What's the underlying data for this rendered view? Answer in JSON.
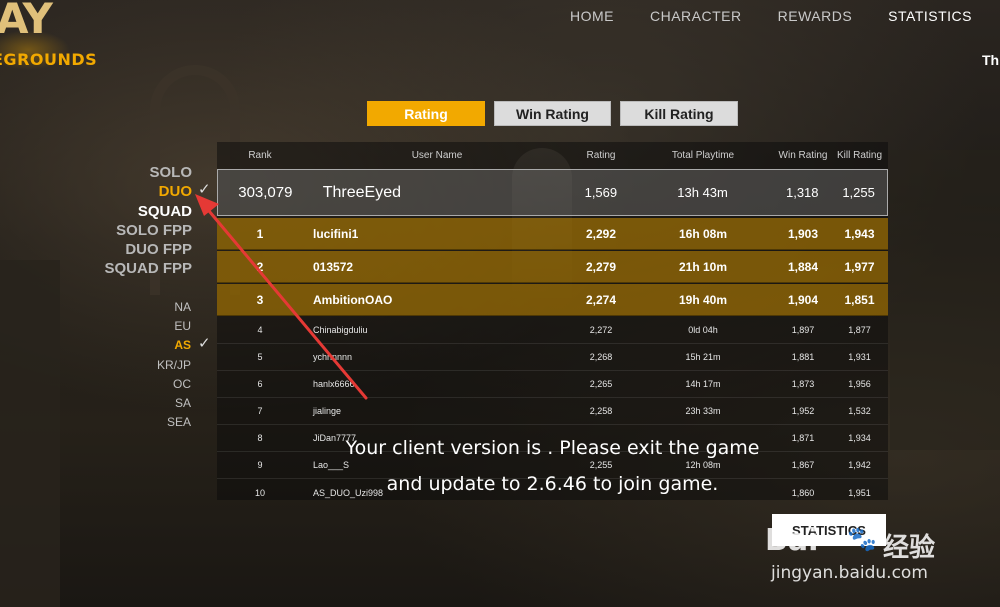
{
  "logo": {
    "big": "AY",
    "small": "EGROUNDS"
  },
  "nav": {
    "items": [
      "HOME",
      "CHARACTER",
      "REWARDS",
      "STATISTICS"
    ],
    "sub": "Th"
  },
  "tabs": [
    "Rating",
    "Win Rating",
    "Kill Rating"
  ],
  "modes": [
    "SOLO",
    "DUO",
    "SQUAD",
    "SOLO FPP",
    "DUO FPP",
    "SQUAD FPP"
  ],
  "regions": [
    "NA",
    "EU",
    "AS",
    "KR/JP",
    "OC",
    "SA",
    "SEA"
  ],
  "check_glyph": "✓",
  "table": {
    "headers": [
      "Rank",
      "User Name",
      "Rating",
      "Total Playtime",
      "Win Rating",
      "Kill Rating"
    ],
    "me": {
      "rank": "303,079",
      "user": "ThreeEyed",
      "rating": "1,569",
      "playtime": "13h 43m",
      "win": "1,318",
      "kill": "1,255"
    },
    "rows": [
      {
        "rank": "1",
        "user": "lucifini1",
        "rating": "2,292",
        "playtime": "16h 08m",
        "win": "1,903",
        "kill": "1,943"
      },
      {
        "rank": "2",
        "user": "013572",
        "rating": "2,279",
        "playtime": "21h 10m",
        "win": "1,884",
        "kill": "1,977"
      },
      {
        "rank": "3",
        "user": "AmbitionOAO",
        "rating": "2,274",
        "playtime": "19h 40m",
        "win": "1,904",
        "kill": "1,851"
      },
      {
        "rank": "4",
        "user": "Chinabigduliu",
        "rating": "2,272",
        "playtime": "0ld 04h",
        "win": "1,897",
        "kill": "1,877"
      },
      {
        "rank": "5",
        "user": "ychnnnnn",
        "rating": "2,268",
        "playtime": "15h 21m",
        "win": "1,881",
        "kill": "1,931"
      },
      {
        "rank": "6",
        "user": "hanlx6666",
        "rating": "2,265",
        "playtime": "14h 17m",
        "win": "1,873",
        "kill": "1,956"
      },
      {
        "rank": "7",
        "user": "jialinge",
        "rating": "2,258",
        "playtime": "23h 33m",
        "win": "1,952",
        "kill": "1,532"
      },
      {
        "rank": "8",
        "user": "JiDan7777",
        "rating": "",
        "playtime": "",
        "win": "1,871",
        "kill": "1,934"
      },
      {
        "rank": "9",
        "user": "Lao___S",
        "rating": "2,255",
        "playtime": "12h 08m",
        "win": "1,867",
        "kill": "1,942"
      },
      {
        "rank": "10",
        "user": "AS_DUO_Uzi998",
        "rating": "",
        "playtime": "",
        "win": "1,860",
        "kill": "1,951"
      }
    ]
  },
  "message": {
    "line1": "Your client version is . Please exit the game",
    "line2": "and update to 2.6.46 to join game."
  },
  "statistics_button": "STATISTICS",
  "watermark": {
    "logo": "Bai",
    "paw": "🐾",
    "cn": "经验",
    "url": "jingyan.baidu.com"
  },
  "colors": {
    "accent": "#f2a900",
    "annotation_arrow": "#e53935"
  }
}
